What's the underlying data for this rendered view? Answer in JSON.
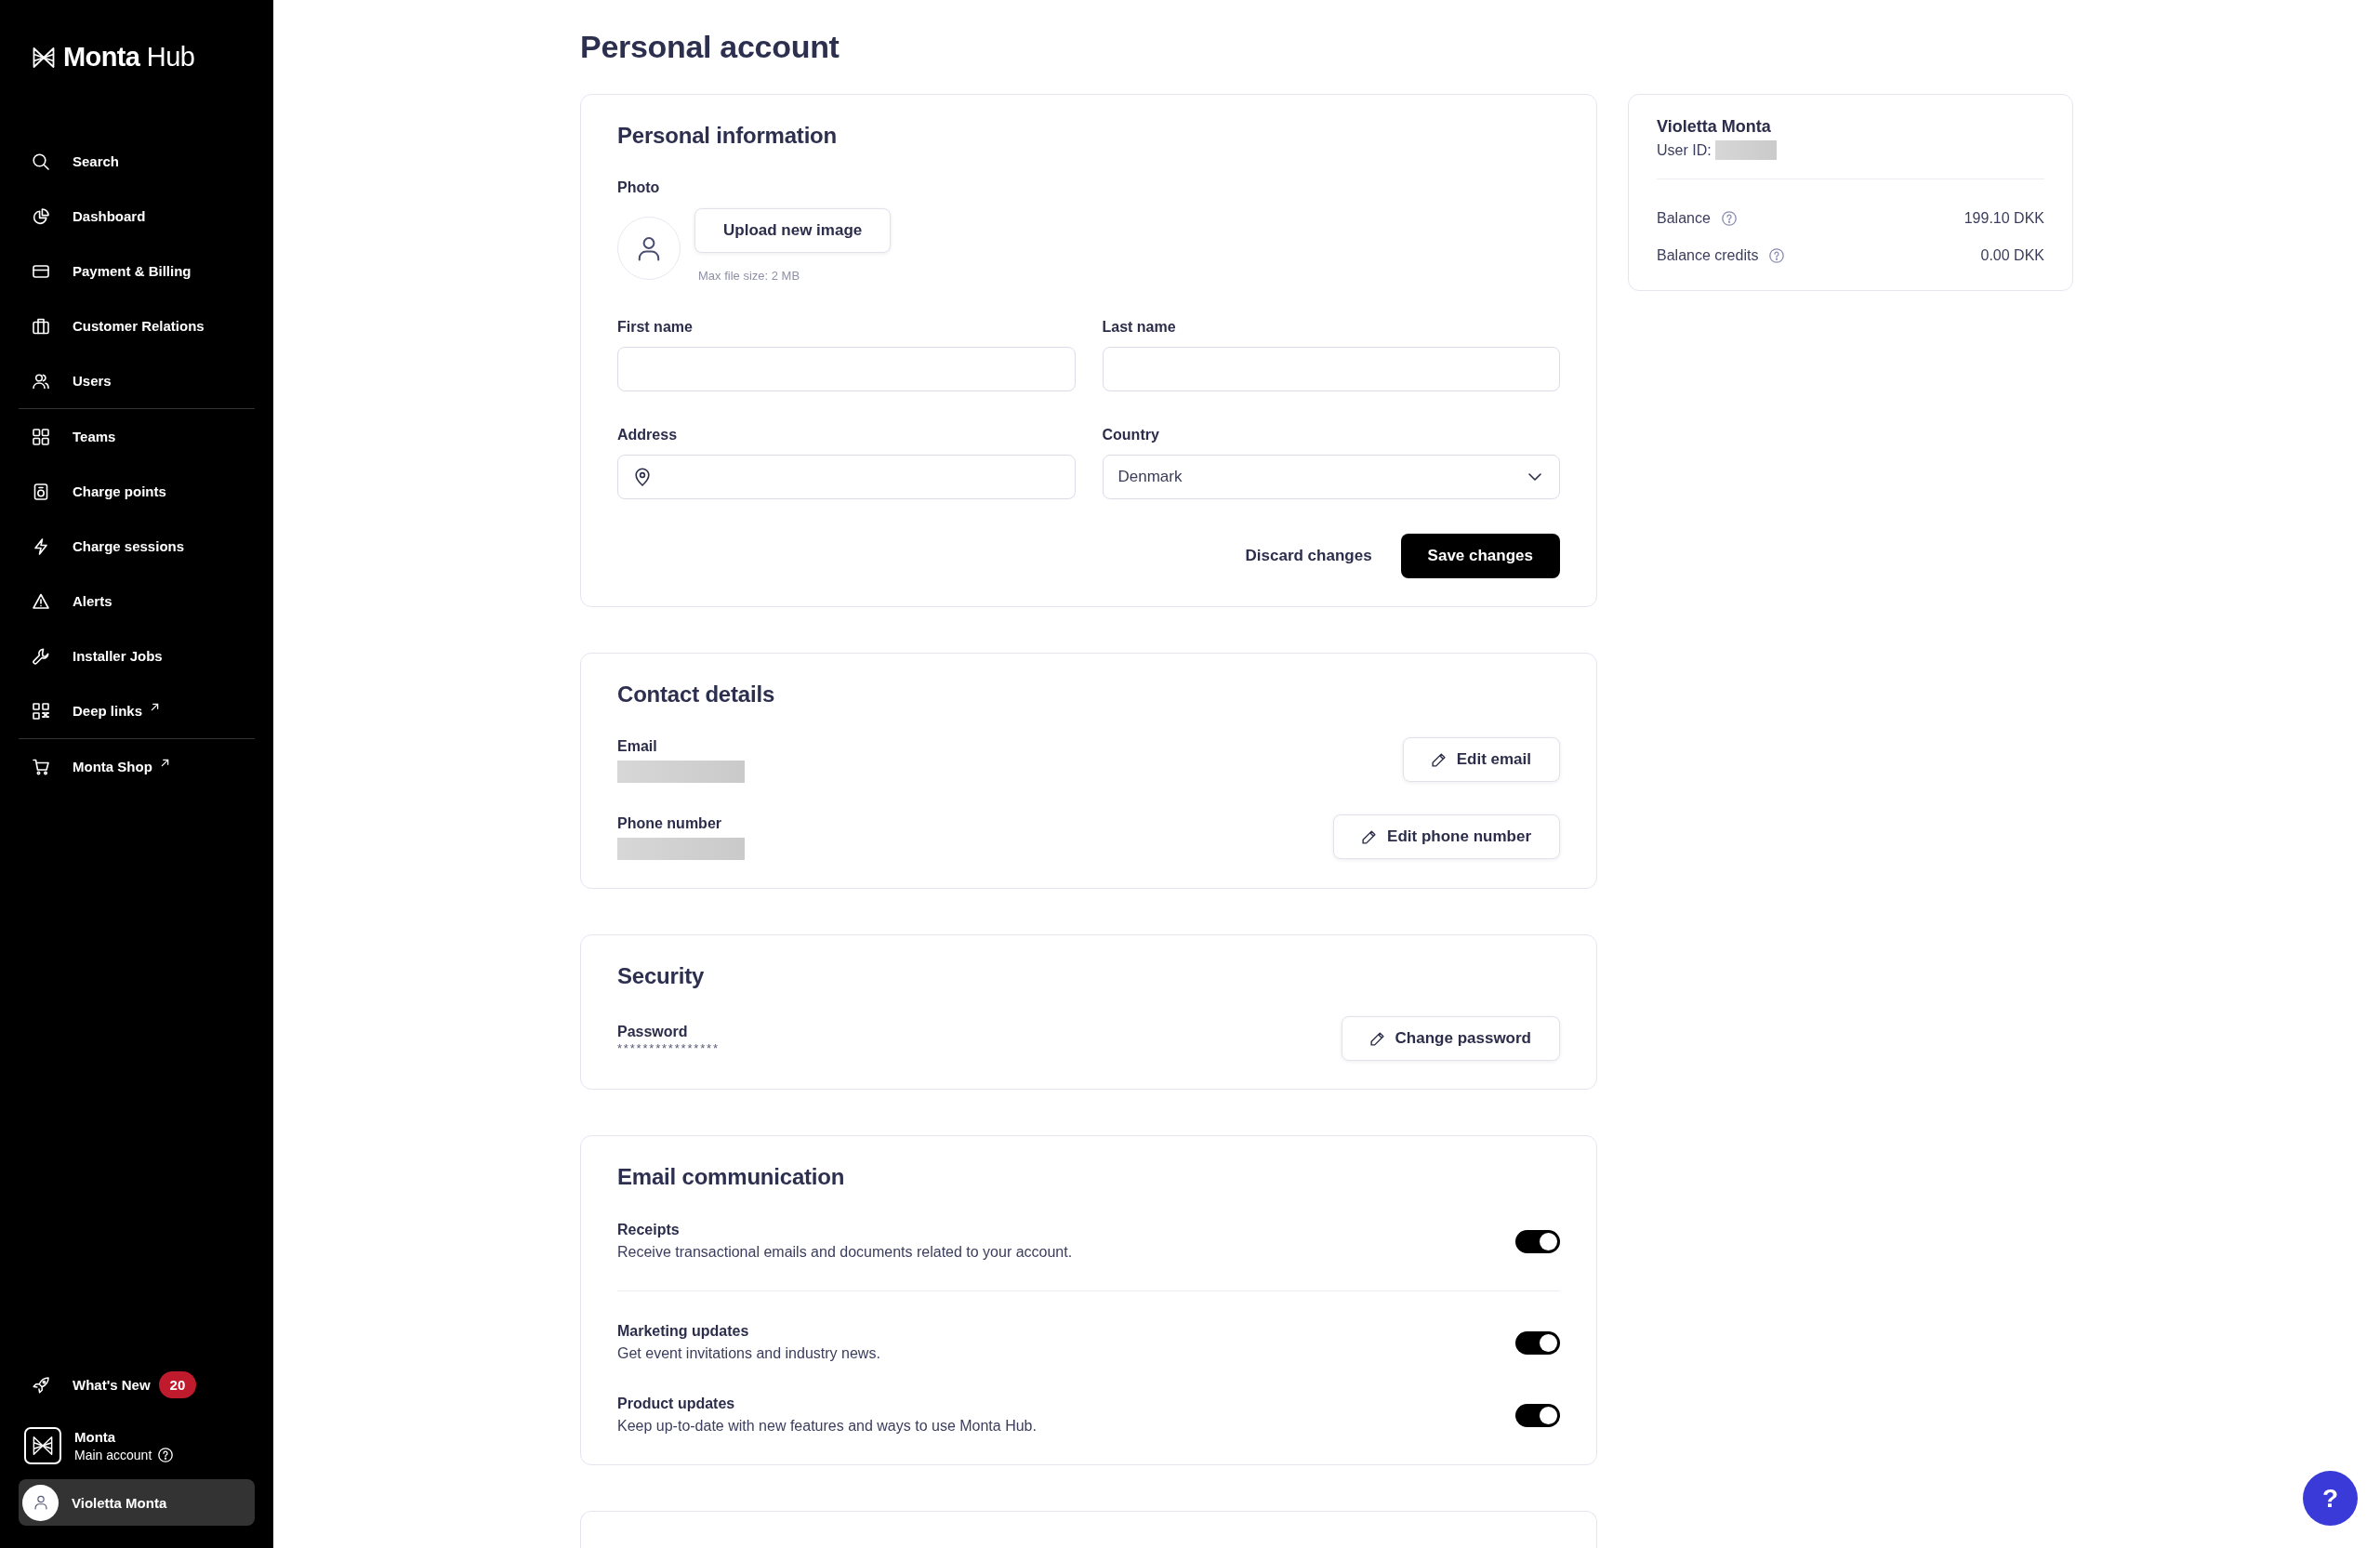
{
  "sidebar": {
    "logo": "**Monta** Hub",
    "nav_groups": [
      [
        {
          "label": "Search",
          "external": false,
          "selected": false
        },
        {
          "label": "Dashboard",
          "external": false,
          "selected": false
        },
        {
          "label": "Payment & Billing",
          "external": false,
          "selected": false
        },
        {
          "label": "Customer Relations",
          "external": false,
          "selected": false
        },
        {
          "label": "Users",
          "external": false,
          "selected": false
        }
      ],
      [
        {
          "label": "Teams",
          "external": false,
          "selected": false
        },
        {
          "label": "Charge points",
          "external": false,
          "selected": false
        },
        {
          "label": "Charge sessions",
          "external": false,
          "selected": false
        },
        {
          "label": "Alerts",
          "external": false,
          "selected": false
        },
        {
          "label": "Installer Jobs",
          "external": false,
          "selected": false
        },
        {
          "label": "Deep links",
          "external": true,
          "selected": false
        }
      ],
      [
        {
          "label": "Monta Shop",
          "external": true,
          "selected": false
        }
      ]
    ],
    "whats_new": {
      "label": "What's New",
      "badge": "20"
    },
    "account": {
      "name": "Monta",
      "subtitle": "Main account"
    },
    "profile": {
      "name": "Violetta Monta",
      "selected": true
    }
  },
  "page_title": "Personal account",
  "personal_information": {
    "title": "Personal information",
    "photo": {
      "label": "Photo",
      "upload_button": "Upload new image",
      "hint": "Max file size: 2 MB"
    },
    "fields": [
      {
        "kind": "text",
        "label": "First name"
      },
      {
        "kind": "text",
        "label": "Last name"
      },
      {
        "kind": "address",
        "label": "Address"
      },
      {
        "kind": "select",
        "label": "Country",
        "value": "Denmark"
      }
    ],
    "buttons": [
      {
        "kind": "text",
        "label": "Discard changes"
      },
      {
        "kind": "primary",
        "label": "Save changes"
      }
    ]
  },
  "contact_details": {
    "title": "Contact details",
    "items": [
      {
        "label": "Email",
        "value_hidden": true,
        "button": "Edit email"
      },
      {
        "label": "Phone number",
        "value_hidden": true,
        "button": "Edit phone number"
      }
    ]
  },
  "security": {
    "title": "Security",
    "items": [
      {
        "label": "Password",
        "value": "****************",
        "button": "Change password"
      }
    ]
  },
  "email_communication": {
    "title": "Email communication",
    "groups": [
      [
        {
          "title": "Receipts",
          "description": "Receive transactional emails and documents related to your account.",
          "on": true
        }
      ],
      [
        {
          "title": "Marketing updates",
          "description": "Get event invitations and industry news.",
          "on": true
        },
        {
          "title": "Product updates",
          "description": "Keep up-to-date with new features and ways to use Monta Hub.",
          "on": true
        }
      ]
    ]
  },
  "account_summary": {
    "name": "Violetta Monta",
    "user_id_label": "User ID:",
    "user_id_hidden": true,
    "rows": [
      {
        "label": "Balance",
        "value": "199.10 DKK"
      },
      {
        "label": "Balance credits",
        "value": "0.00 DKK"
      }
    ]
  },
  "help_button": {
    "label": "?"
  }
}
